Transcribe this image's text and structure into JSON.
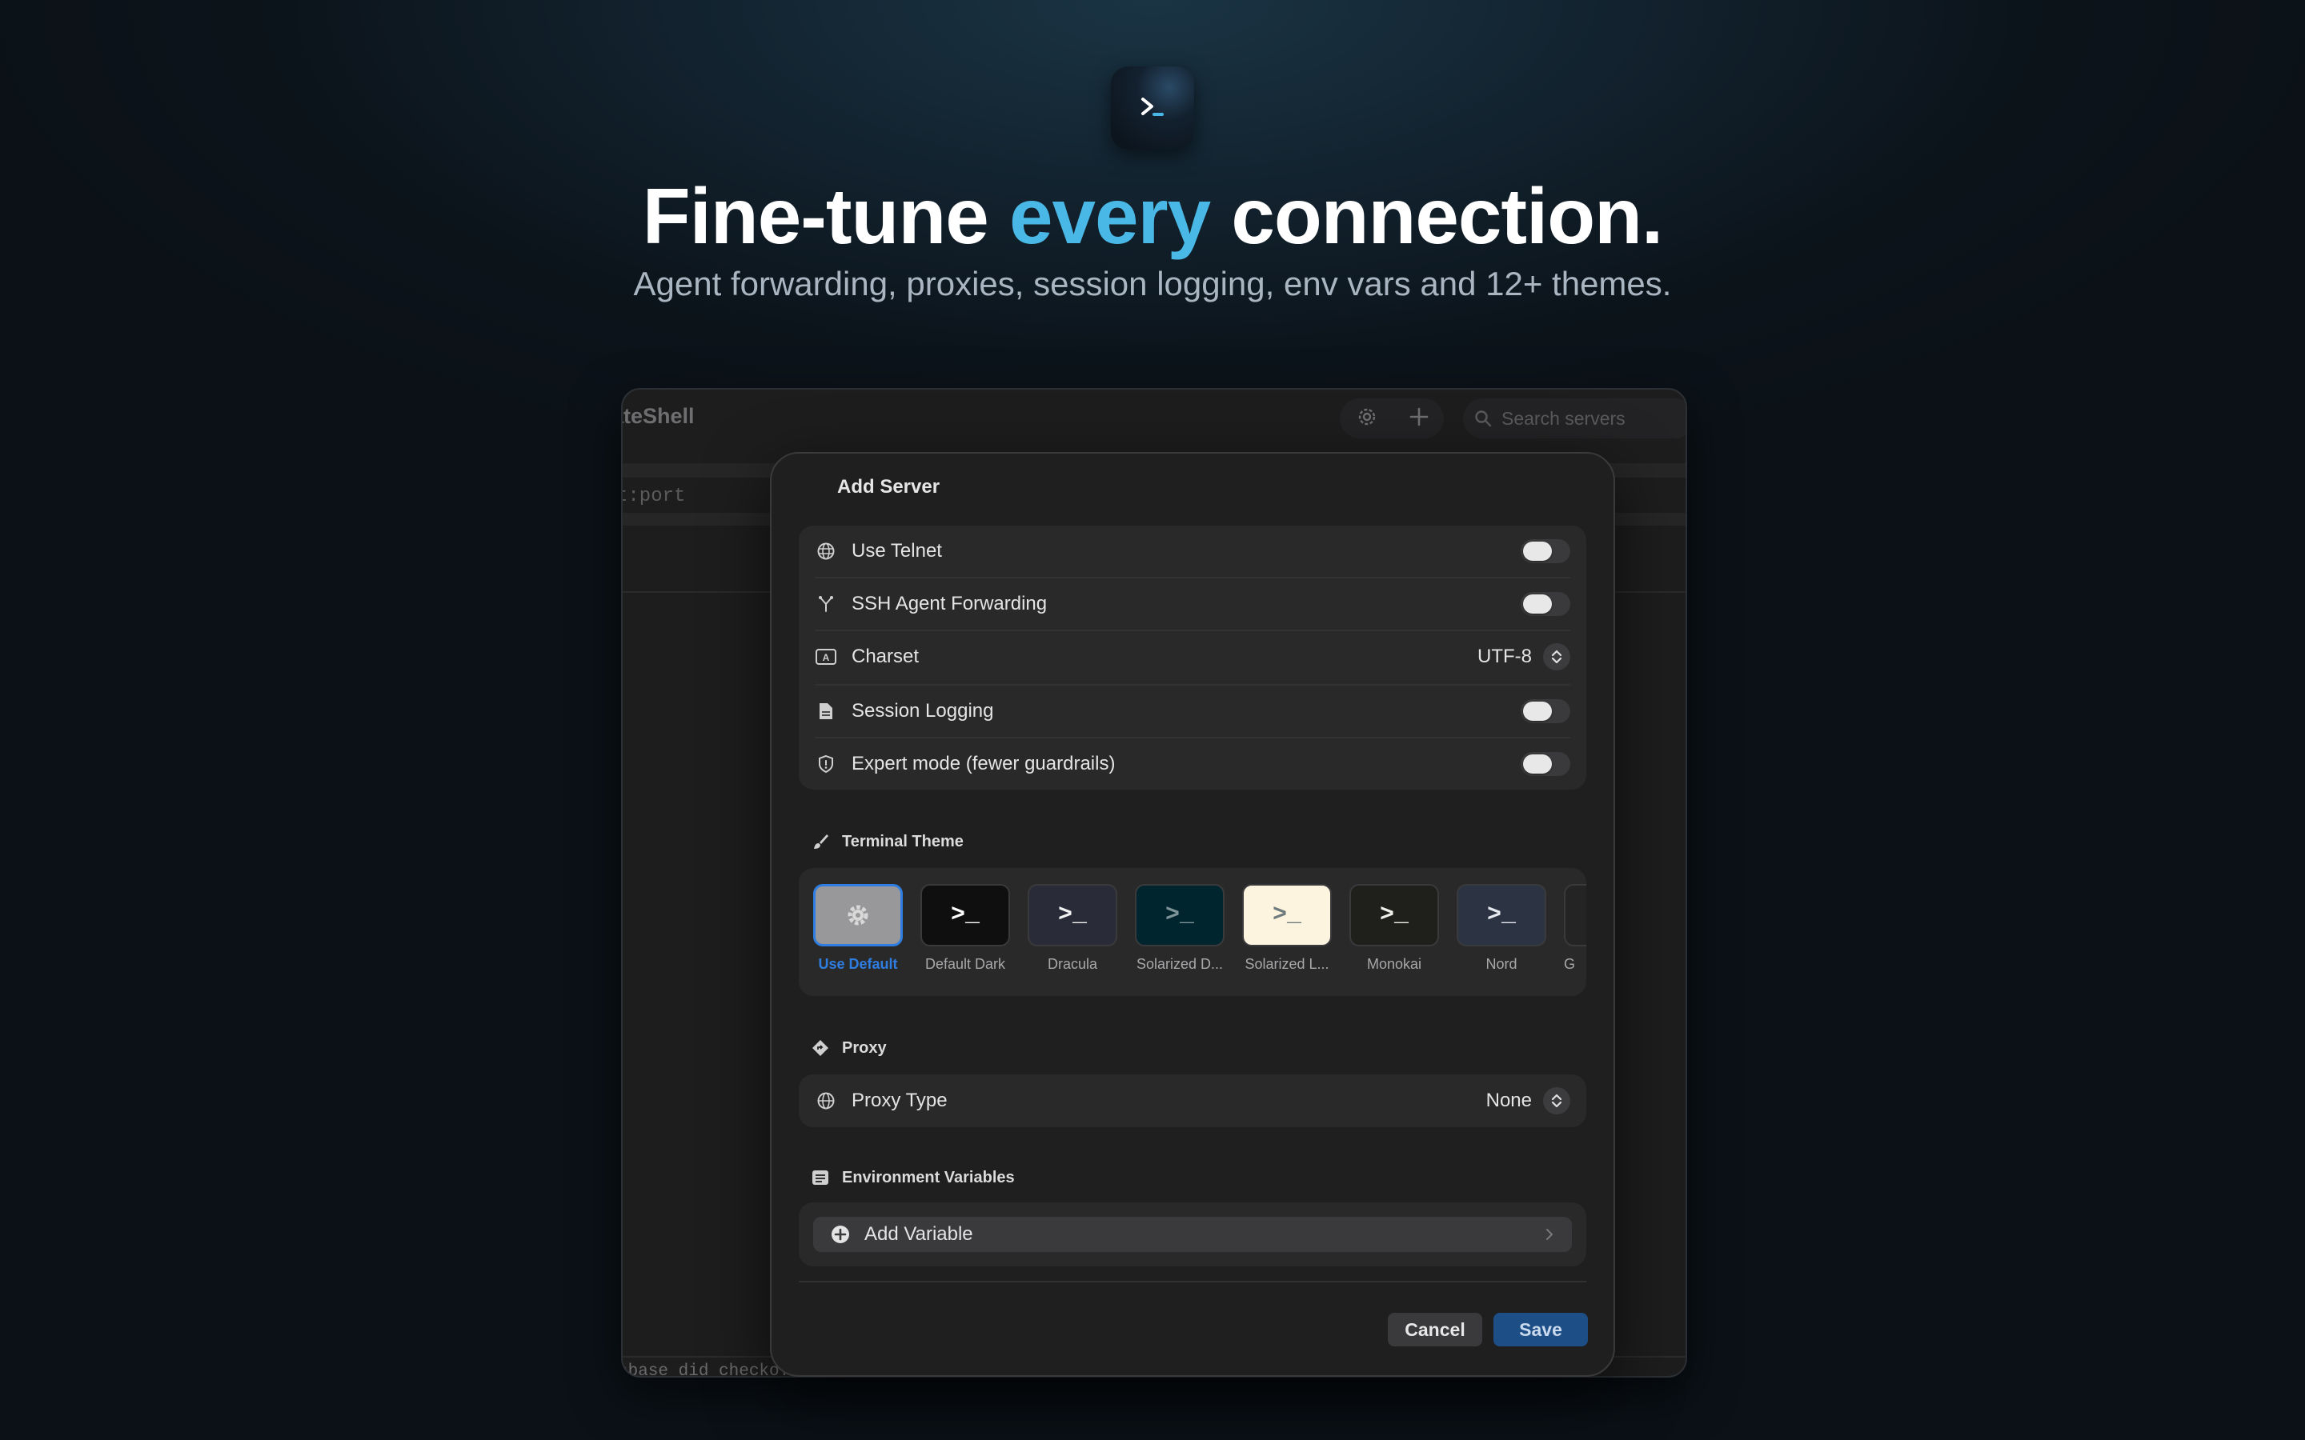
{
  "hero": {
    "headline_pre": "Fine-tune ",
    "headline_accent": "every",
    "headline_post": " connection.",
    "subheadline": "Agent forwarding, proxies, session logging, env vars and 12+ themes.",
    "accent_color": "#4ab8e6"
  },
  "window": {
    "app_title": "ateShell",
    "search_placeholder": "Search servers",
    "host_hint": "t:port",
    "bottom_log": "abase did checko..."
  },
  "dialog": {
    "title": "Add Server",
    "options": [
      {
        "icon": "globe-grid-icon",
        "label": "Use Telnet",
        "control": "toggle",
        "on": false
      },
      {
        "icon": "fork-icon",
        "label": "SSH Agent Forwarding",
        "control": "toggle",
        "on": false
      },
      {
        "icon": "charset-icon",
        "label": "Charset",
        "control": "select",
        "value": "UTF-8"
      },
      {
        "icon": "document-icon",
        "label": "Session Logging",
        "control": "toggle",
        "on": false
      },
      {
        "icon": "shield-icon",
        "label": "Expert mode (fewer guardrails)",
        "control": "toggle",
        "on": false
      }
    ],
    "terminal_theme": {
      "heading": "Terminal Theme",
      "themes": [
        {
          "name": "Use Default",
          "selected": true
        },
        {
          "name": "Default Dark"
        },
        {
          "name": "Dracula"
        },
        {
          "name": "Solarized D..."
        },
        {
          "name": "Solarized L..."
        },
        {
          "name": "Monokai"
        },
        {
          "name": "Nord"
        },
        {
          "name": "G"
        }
      ],
      "prompt_glyph": ">_"
    },
    "proxy": {
      "heading": "Proxy",
      "type_label": "Proxy Type",
      "type_value": "None"
    },
    "env": {
      "heading": "Environment Variables",
      "add_label": "Add Variable"
    },
    "buttons": {
      "cancel": "Cancel",
      "save": "Save"
    }
  }
}
